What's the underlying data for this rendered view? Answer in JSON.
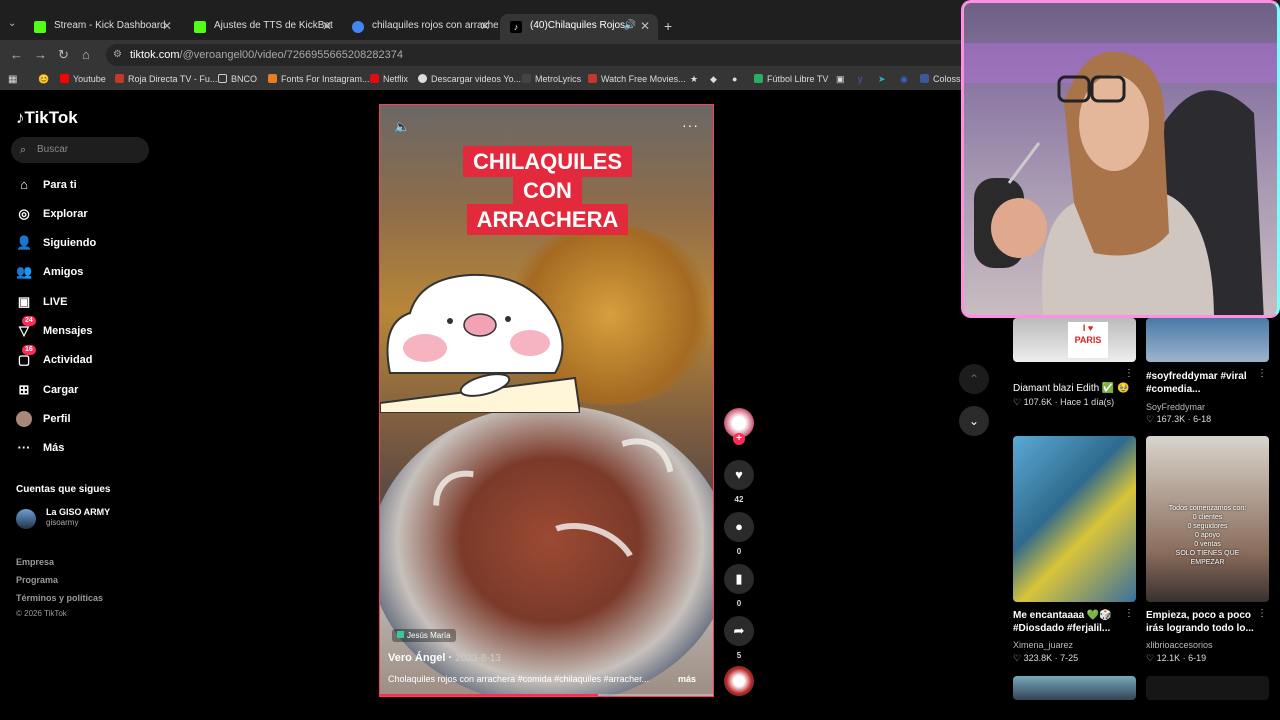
{
  "browser": {
    "tabs": [
      {
        "label": "Stream - Kick Dashboard",
        "color": "#53fc18"
      },
      {
        "label": "Ajustes de TTS de KickBot",
        "color": "#53fc18"
      },
      {
        "label": "chilaquiles rojos con arrachera",
        "color": "#4285f4"
      },
      {
        "label": "(40)Chilaquiles Rojos con A",
        "color": "#ffffff"
      }
    ],
    "url_host": "tiktok.com",
    "url_path": "/@veroangel00/video/7266955665208282374",
    "bookmarks": [
      {
        "label": "Youtube",
        "color": "#ff0000"
      },
      {
        "label": "Roja Directa TV - Fu...",
        "color": "#c0392b"
      },
      {
        "label": "BNCO",
        "color": "#888888"
      },
      {
        "label": "Fonts For Instagram...",
        "color": "#e67e22"
      },
      {
        "label": "Netflix",
        "color": "#e50914"
      },
      {
        "label": "Descargar videos Yo...",
        "color": "#dddddd"
      },
      {
        "label": "MetroLyrics",
        "color": "#444444"
      },
      {
        "label": "Watch Free Movies...",
        "color": "#c0392b"
      },
      {
        "label": "Fútbol Libre TV",
        "color": "#27ae60"
      },
      {
        "label": "Coloss",
        "color": "#3b5998"
      }
    ]
  },
  "sidebar": {
    "logo": "TikTok",
    "search_placeholder": "Buscar",
    "items": [
      {
        "label": "Para ti",
        "icon": "home-icon"
      },
      {
        "label": "Explorar",
        "icon": "compass-icon"
      },
      {
        "label": "Siguiendo",
        "icon": "following-icon"
      },
      {
        "label": "Amigos",
        "icon": "friends-icon"
      },
      {
        "label": "LIVE",
        "icon": "live-icon"
      },
      {
        "label": "Mensajes",
        "icon": "messages-icon",
        "badge": "24"
      },
      {
        "label": "Actividad",
        "icon": "activity-icon",
        "badge": "16"
      },
      {
        "label": "Cargar",
        "icon": "upload-icon"
      },
      {
        "label": "Perfil",
        "icon": "profile-icon"
      },
      {
        "label": "Más",
        "icon": "more-icon"
      }
    ],
    "following_header": "Cuentas que sigues",
    "following": [
      {
        "name": "La GISO ARMY",
        "user": "gisoarmy"
      }
    ],
    "footer": [
      "Empresa",
      "Programa",
      "Términos y políticas",
      "© 2026 TikTok"
    ]
  },
  "video": {
    "overlay_title": [
      "CHILAQUILES",
      "CON",
      "ARRACHERA"
    ],
    "location": "Jesús María",
    "author": "Vero Ángel",
    "date": "2023-8-13",
    "description": "Cholaquiles rojos con arrachera #comida #chilaquiles #arracher...",
    "more_label": "más",
    "progress": 0.65
  },
  "actions": {
    "likes": "42",
    "comments": "0",
    "saves": "0",
    "shares": "5"
  },
  "recommended": [
    {
      "title": "Diamant blazi Edith ✅ 🥹",
      "user": "",
      "stats": "107.6K · Hace 1 día(s)"
    },
    {
      "title": "#soyfreddymar #viral #comedia...",
      "user": "SoyFreddymar",
      "stats": "167.3K · 6-18"
    },
    {
      "title": "Me encantaaaa 💚🎲 #Diosdado #ferjalil...",
      "user": "Ximena_juarez",
      "stats": "323.8K · 7-25"
    },
    {
      "title": "Empieza, poco a poco irás logrando todo lo...",
      "user": "xlibrioaccesorios",
      "stats": "12.1K · 6-19"
    }
  ],
  "thumb_text": [
    "Todos comenzamos con:",
    "0 clientes",
    "0 seguidores",
    "0 apoyo",
    "0 ventas",
    "SOLO TIENES QUE",
    "EMPEZAR"
  ]
}
